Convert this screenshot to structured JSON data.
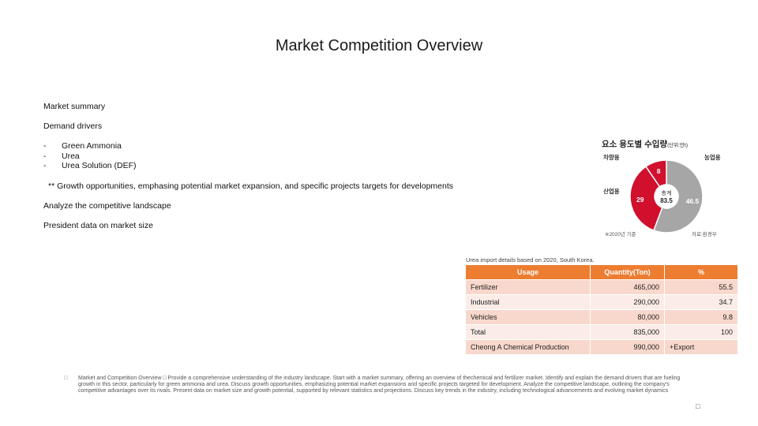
{
  "slide": {
    "title": "Market Competition Overview"
  },
  "content": {
    "market_summary": "Market summary",
    "demand_drivers": "Demand drivers",
    "bullets": [
      "Green Ammonia",
      "Urea",
      "Urea Solution (DEF)"
    ],
    "bullet_marker": "-",
    "growth_note": "** Growth opportunities, emphasing potential market expansion, and specific projects targets for developments",
    "competitive": "Analyze the competitive landscape",
    "president": "President data on market size"
  },
  "chart": {
    "title_main": "요소 용도별 수입량",
    "title_unit": "(단위:만t)",
    "center_label": "총계",
    "center_value": "83.5",
    "label_vehicle": "차량용",
    "label_industrial": "산업용",
    "label_agri": "농업용",
    "footnote_left": "※2020년 기준",
    "footnote_right": "자료:환경부",
    "colors": {
      "agri": "#a6a6a6",
      "industrial": "#d0102c",
      "vehicle": "#d0102c"
    }
  },
  "chart_data": {
    "type": "pie",
    "categories": [
      "농업용",
      "산업용",
      "차량용"
    ],
    "values": [
      46.5,
      29,
      8
    ],
    "total": 83.5
  },
  "table": {
    "caption": "Urea import details based on 2020, South Korea.",
    "headers": [
      "Usage",
      "Quantity(Ton)",
      "%"
    ],
    "rows": [
      [
        "Fertilizer",
        "465,000",
        "55.5"
      ],
      [
        "Industrial",
        "290,000",
        "34.7"
      ],
      [
        "Vehicles",
        "80,000",
        "9.8"
      ],
      [
        "Total",
        "835,000",
        "100"
      ],
      [
        "Cheong A Chemical Production",
        "990,000",
        "+Export"
      ]
    ]
  },
  "notes": {
    "glyph": "□",
    "text": "Market and Competition Overview □ Provide a comprehensive understanding of the industry landscape. Start with a market summary, offering an overview of thechemical and fertilizer market. Identify and explain the demand drivers that are fueling growth in this sector, particularly for green ammonia and urea. Discuss growth opportunities, emphasizing potential market expansions and specific projects targeted for development. Analyze the competitive landscape, outlining the company's competitive advantages over its rivals. Present data on market size and growth potential, supported by relevant statistics and projections. Discuss key trends in the industry, including technological advancements and evolving market dynamics",
    "corner_glyph": "□"
  }
}
